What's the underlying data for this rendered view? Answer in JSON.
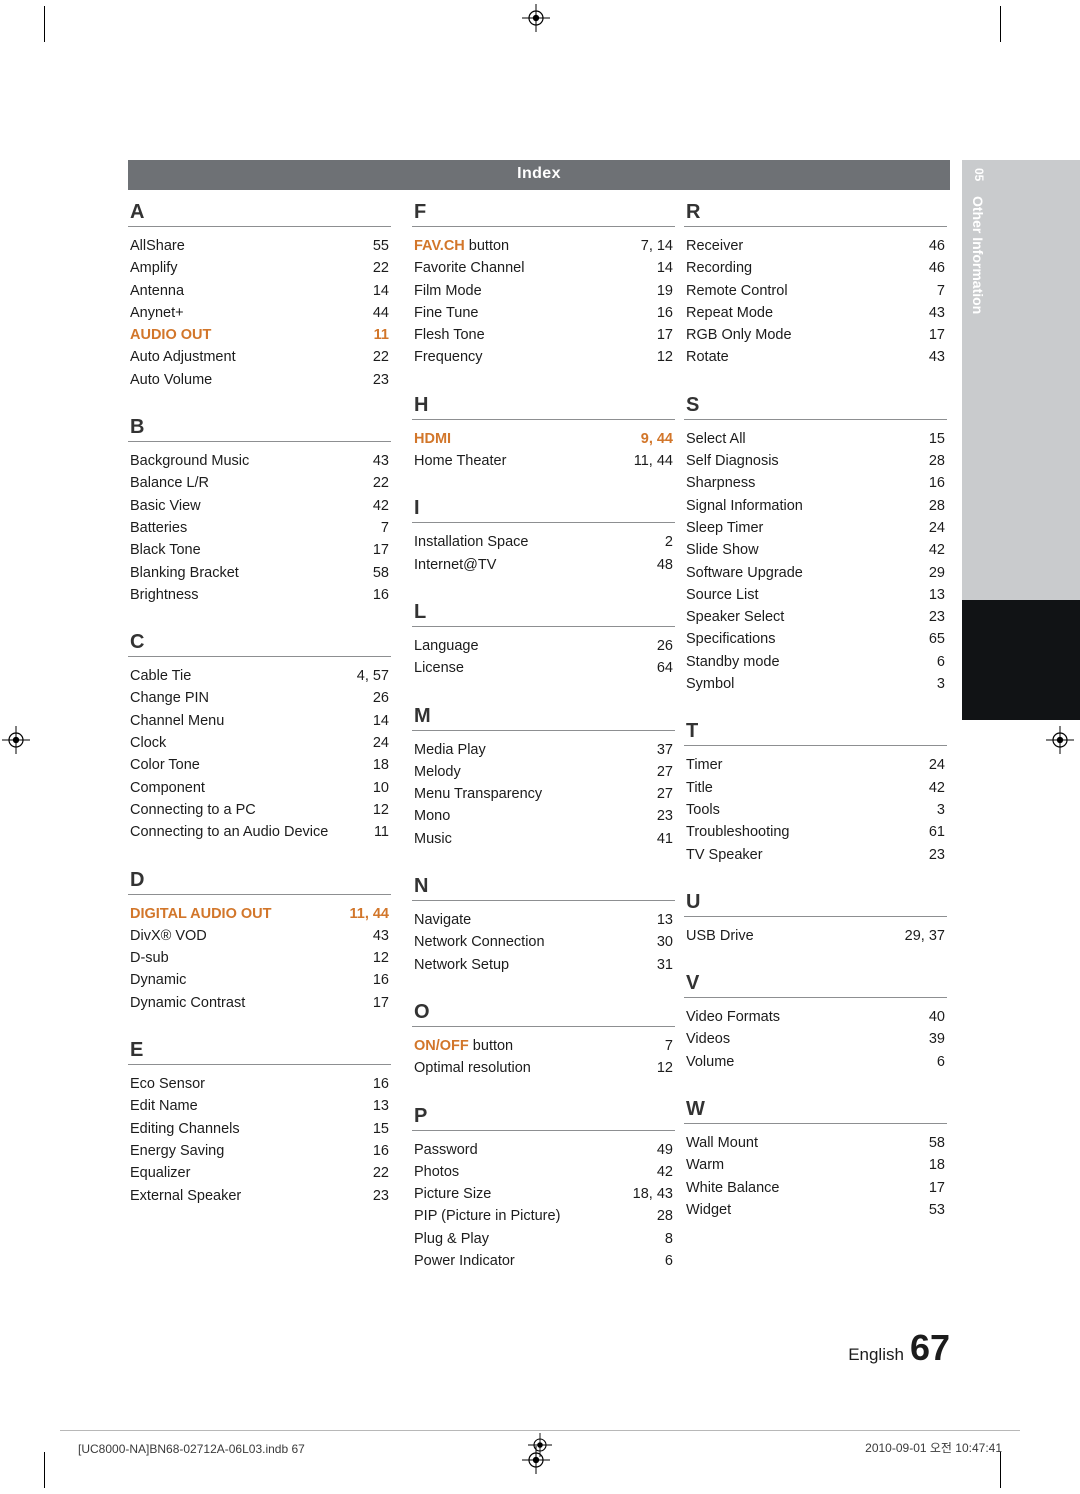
{
  "header": {
    "title": "Index"
  },
  "side_tab": {
    "number": "05",
    "label": "Other Information"
  },
  "columns": [
    {
      "sections": [
        {
          "letter": "A",
          "entries": [
            {
              "label": "AllShare",
              "page": "55",
              "style": "plain"
            },
            {
              "label": "Amplify",
              "page": "22",
              "style": "plain"
            },
            {
              "label": "Antenna",
              "page": "14",
              "style": "plain"
            },
            {
              "label": "Anynet+",
              "page": "44",
              "style": "plain"
            },
            {
              "label": "AUDIO OUT",
              "page": "11",
              "style": "orange"
            },
            {
              "label": "Auto Adjustment",
              "page": "22",
              "style": "plain"
            },
            {
              "label": "Auto Volume",
              "page": "23",
              "style": "plain"
            }
          ]
        },
        {
          "letter": "B",
          "entries": [
            {
              "label": "Background Music",
              "page": "43",
              "style": "plain"
            },
            {
              "label": "Balance L/R",
              "page": "22",
              "style": "plain"
            },
            {
              "label": "Basic View",
              "page": "42",
              "style": "plain"
            },
            {
              "label": "Batteries",
              "page": "7",
              "style": "plain"
            },
            {
              "label": "Black Tone",
              "page": "17",
              "style": "plain"
            },
            {
              "label": "Blanking Bracket",
              "page": "58",
              "style": "plain"
            },
            {
              "label": "Brightness",
              "page": "16",
              "style": "plain"
            }
          ]
        },
        {
          "letter": "C",
          "entries": [
            {
              "label": "Cable Tie",
              "page": "4, 57",
              "style": "plain"
            },
            {
              "label": "Change PIN",
              "page": "26",
              "style": "plain"
            },
            {
              "label": "Channel Menu",
              "page": "14",
              "style": "plain"
            },
            {
              "label": "Clock",
              "page": "24",
              "style": "plain"
            },
            {
              "label": "Color Tone",
              "page": "18",
              "style": "plain"
            },
            {
              "label": "Component",
              "page": "10",
              "style": "plain"
            },
            {
              "label": "Connecting to a PC",
              "page": "12",
              "style": "plain"
            },
            {
              "label": "Connecting to an Audio Device",
              "page": "11",
              "style": "plain"
            }
          ]
        },
        {
          "letter": "D",
          "entries": [
            {
              "label": "DIGITAL AUDIO OUT",
              "page": "11, 44",
              "style": "orange"
            },
            {
              "label": "DivX® VOD",
              "page": "43",
              "style": "plain"
            },
            {
              "label": "D-sub",
              "page": "12",
              "style": "plain"
            },
            {
              "label": "Dynamic",
              "page": "16",
              "style": "plain"
            },
            {
              "label": "Dynamic Contrast",
              "page": "17",
              "style": "plain"
            }
          ]
        },
        {
          "letter": "E",
          "entries": [
            {
              "label": "Eco Sensor",
              "page": "16",
              "style": "plain"
            },
            {
              "label": "Edit Name",
              "page": "13",
              "style": "plain"
            },
            {
              "label": "Editing Channels",
              "page": "15",
              "style": "plain"
            },
            {
              "label": "Energy Saving",
              "page": "16",
              "style": "plain"
            },
            {
              "label": "Equalizer",
              "page": "22",
              "style": "plain"
            },
            {
              "label": "External Speaker",
              "page": "23",
              "style": "plain"
            }
          ]
        }
      ]
    },
    {
      "sections": [
        {
          "letter": "F",
          "entries": [
            {
              "label": "FAV.CH button",
              "page": "7, 14",
              "style": "orange-lead",
              "lead": "FAV.CH",
              "rest": " button"
            },
            {
              "label": "Favorite Channel",
              "page": "14",
              "style": "plain"
            },
            {
              "label": "Film Mode",
              "page": "19",
              "style": "plain"
            },
            {
              "label": "Fine Tune",
              "page": "16",
              "style": "plain"
            },
            {
              "label": "Flesh Tone",
              "page": "17",
              "style": "plain"
            },
            {
              "label": "Frequency",
              "page": "12",
              "style": "plain"
            }
          ]
        },
        {
          "letter": "H",
          "entries": [
            {
              "label": "HDMI",
              "page": "9, 44",
              "style": "orange"
            },
            {
              "label": "Home Theater",
              "page": "11, 44",
              "style": "plain"
            }
          ]
        },
        {
          "letter": "I",
          "entries": [
            {
              "label": "Installation Space",
              "page": "2",
              "style": "plain"
            },
            {
              "label": "Internet@TV",
              "page": "48",
              "style": "plain"
            }
          ]
        },
        {
          "letter": "L",
          "entries": [
            {
              "label": "Language",
              "page": "26",
              "style": "plain"
            },
            {
              "label": "License",
              "page": "64",
              "style": "plain"
            }
          ]
        },
        {
          "letter": "M",
          "entries": [
            {
              "label": "Media Play",
              "page": "37",
              "style": "plain"
            },
            {
              "label": "Melody",
              "page": "27",
              "style": "plain"
            },
            {
              "label": "Menu Transparency",
              "page": "27",
              "style": "plain"
            },
            {
              "label": "Mono",
              "page": "23",
              "style": "plain"
            },
            {
              "label": "Music",
              "page": "41",
              "style": "plain"
            }
          ]
        },
        {
          "letter": "N",
          "entries": [
            {
              "label": "Navigate",
              "page": "13",
              "style": "plain"
            },
            {
              "label": "Network Connection",
              "page": "30",
              "style": "plain"
            },
            {
              "label": "Network Setup",
              "page": "31",
              "style": "plain"
            }
          ]
        },
        {
          "letter": "O",
          "entries": [
            {
              "label": "ON/OFF button",
              "page": "7",
              "style": "orange-lead",
              "lead": "ON/OFF",
              "rest": " button"
            },
            {
              "label": "Optimal resolution",
              "page": "12",
              "style": "plain"
            }
          ]
        },
        {
          "letter": "P",
          "entries": [
            {
              "label": "Password",
              "page": "49",
              "style": "plain"
            },
            {
              "label": "Photos",
              "page": "42",
              "style": "plain"
            },
            {
              "label": "Picture Size",
              "page": "18, 43",
              "style": "plain"
            },
            {
              "label": "PIP (Picture in Picture)",
              "page": "28",
              "style": "plain"
            },
            {
              "label": "Plug & Play",
              "page": "8",
              "style": "plain"
            },
            {
              "label": "Power Indicator",
              "page": "6",
              "style": "plain"
            }
          ]
        }
      ]
    },
    {
      "sections": [
        {
          "letter": "R",
          "entries": [
            {
              "label": "Receiver",
              "page": "46",
              "style": "plain"
            },
            {
              "label": "Recording",
              "page": "46",
              "style": "plain"
            },
            {
              "label": "Remote Control",
              "page": "7",
              "style": "plain"
            },
            {
              "label": "Repeat Mode",
              "page": "43",
              "style": "plain"
            },
            {
              "label": "RGB Only Mode",
              "page": "17",
              "style": "plain"
            },
            {
              "label": "Rotate",
              "page": "43",
              "style": "plain"
            }
          ]
        },
        {
          "letter": "S",
          "entries": [
            {
              "label": "Select All",
              "page": "15",
              "style": "plain"
            },
            {
              "label": "Self Diagnosis",
              "page": "28",
              "style": "plain"
            },
            {
              "label": "Sharpness",
              "page": "16",
              "style": "plain"
            },
            {
              "label": "Signal Information",
              "page": "28",
              "style": "plain"
            },
            {
              "label": "Sleep Timer",
              "page": "24",
              "style": "plain"
            },
            {
              "label": "Slide Show",
              "page": "42",
              "style": "plain"
            },
            {
              "label": "Software Upgrade",
              "page": "29",
              "style": "plain"
            },
            {
              "label": "Source List",
              "page": "13",
              "style": "plain"
            },
            {
              "label": "Speaker Select",
              "page": "23",
              "style": "plain"
            },
            {
              "label": "Specifications",
              "page": "65",
              "style": "plain"
            },
            {
              "label": "Standby mode",
              "page": "6",
              "style": "plain"
            },
            {
              "label": "Symbol",
              "page": "3",
              "style": "plain"
            }
          ]
        },
        {
          "letter": "T",
          "entries": [
            {
              "label": "Timer",
              "page": "24",
              "style": "plain"
            },
            {
              "label": "Title",
              "page": "42",
              "style": "plain"
            },
            {
              "label": "Tools",
              "page": "3",
              "style": "plain"
            },
            {
              "label": "Troubleshooting",
              "page": "61",
              "style": "plain"
            },
            {
              "label": "TV Speaker",
              "page": "23",
              "style": "plain"
            }
          ]
        },
        {
          "letter": "U",
          "entries": [
            {
              "label": "USB Drive",
              "page": "29, 37",
              "style": "plain"
            }
          ]
        },
        {
          "letter": "V",
          "entries": [
            {
              "label": "Video Formats",
              "page": "40",
              "style": "plain"
            },
            {
              "label": "Videos",
              "page": "39",
              "style": "plain"
            },
            {
              "label": "Volume",
              "page": "6",
              "style": "plain"
            }
          ]
        },
        {
          "letter": "W",
          "entries": [
            {
              "label": "Wall Mount",
              "page": "58",
              "style": "plain"
            },
            {
              "label": "Warm",
              "page": "18",
              "style": "plain"
            },
            {
              "label": "White Balance",
              "page": "17",
              "style": "plain"
            },
            {
              "label": "Widget",
              "page": "53",
              "style": "plain"
            }
          ]
        }
      ]
    }
  ],
  "page_footer": {
    "language": "English",
    "page_number": "67",
    "file_info": "[UC8000-NA]BN68-02712A-06L03.indb   67",
    "timestamp": "2010-09-01   오전 10:47:41"
  }
}
